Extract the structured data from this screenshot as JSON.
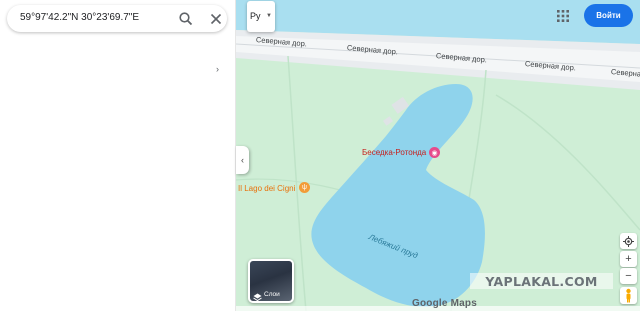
{
  "search": {
    "query": "59°97'42.2\"N 30°23'69.7\"E"
  },
  "icons": {
    "search": "search-icon",
    "close": "close-icon",
    "collapse": "chevron-left-icon",
    "apps": "apps-grid-icon",
    "layers": "layers-icon",
    "locate": "my-location-icon",
    "zoom_in": "plus-icon",
    "zoom_out": "minus-icon",
    "pegman": "pegman-icon",
    "poi_restaurant": "restaurant-icon",
    "poi_camera": "camera-icon"
  },
  "layer_select": {
    "value": "Ру"
  },
  "header": {
    "signin_label": "Войти"
  },
  "map": {
    "roads": [
      {
        "label": "Северная дор."
      },
      {
        "label": "Северная дор."
      },
      {
        "label": "Северная дор."
      },
      {
        "label": "Северная дор."
      },
      {
        "label": "Северная дор."
      }
    ],
    "lake_label": "Лебяжий пруд",
    "pois": [
      {
        "label": "Беседка-Ротонда"
      },
      {
        "label": "Il Lago dei Cigni"
      }
    ],
    "layers_label": "Слои",
    "logo": "Google Maps"
  },
  "watermark": "YAPLAKAL.COM",
  "colors": {
    "park": "#cfeed6",
    "water": "#8fd3ec",
    "river": "#a9dff0",
    "road": "#e7ebee",
    "accent": "#1a73e8"
  }
}
